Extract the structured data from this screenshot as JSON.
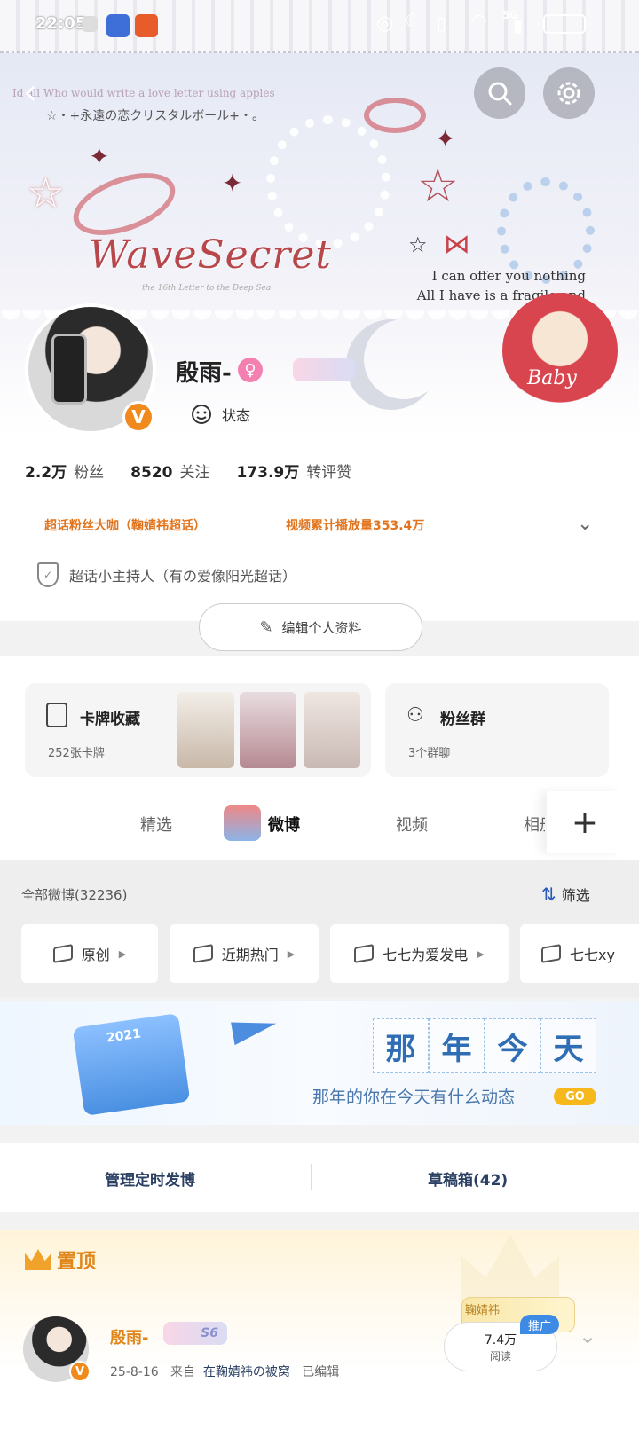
{
  "status_bar": {
    "time": "22:05",
    "network": "5G"
  },
  "banner": {
    "line1": "Id all Who would write a love letter using apples",
    "line2": "☆・+永遠の恋クリスタルボール+・。",
    "logo": "WaveSecret",
    "logo_sub": "the 16th Letter to the Deep Sea",
    "quote_line1": "I can offer you nothing",
    "quote_line2": "All I have is a fragile and bad soul",
    "sticker_text": "Baby"
  },
  "profile": {
    "name": "殷雨-",
    "verified_mark": "V",
    "status_label": "状态",
    "stats": [
      {
        "value": "2.2万",
        "label": "粉丝"
      },
      {
        "value": "8520",
        "label": "关注"
      },
      {
        "value": "173.9万",
        "label": "转评赞"
      }
    ],
    "badges": [
      "超话粉丝大咖（鞠婧祎超话）",
      "视频累计播放量353.4万"
    ],
    "host": "超话小主持人（有の爱像阳光超话）",
    "edit_button": "编辑个人资料"
  },
  "cards": {
    "collection": {
      "title": "卡牌收藏",
      "subtitle": "252张卡牌"
    },
    "fans": {
      "title": "粉丝群",
      "subtitle": "3个群聊"
    }
  },
  "tabs": [
    "精选",
    "微博",
    "视频",
    "相册"
  ],
  "filters": {
    "all_label": "全部微博(32236)",
    "filter_button": "筛选",
    "chips": [
      "原创",
      "近期热门",
      "七七为爱发电",
      "七七xy"
    ]
  },
  "promo": {
    "title_chars": [
      "那",
      "年",
      "今",
      "天"
    ],
    "subtitle": "那年的你在今天有什么动态",
    "go": "GO",
    "calendar_year": "2021"
  },
  "manage": {
    "scheduled": "管理定时发博",
    "drafts": "草稿箱(42)"
  },
  "pinned": {
    "title": "置顶",
    "post": {
      "author": "殷雨-",
      "level": "S6",
      "date": "25-8-16",
      "from_label": "来自",
      "source": "在鞠婧祎の被窝",
      "edited": "已编辑",
      "reads_value": "7.4万",
      "reads_label": "阅读",
      "promote": "推广",
      "stamp": "鞠婧祎"
    }
  },
  "colors": {
    "accent_orange": "#e0861a",
    "link_blue": "#2a3f63",
    "promote_blue": "#3e8be6"
  }
}
